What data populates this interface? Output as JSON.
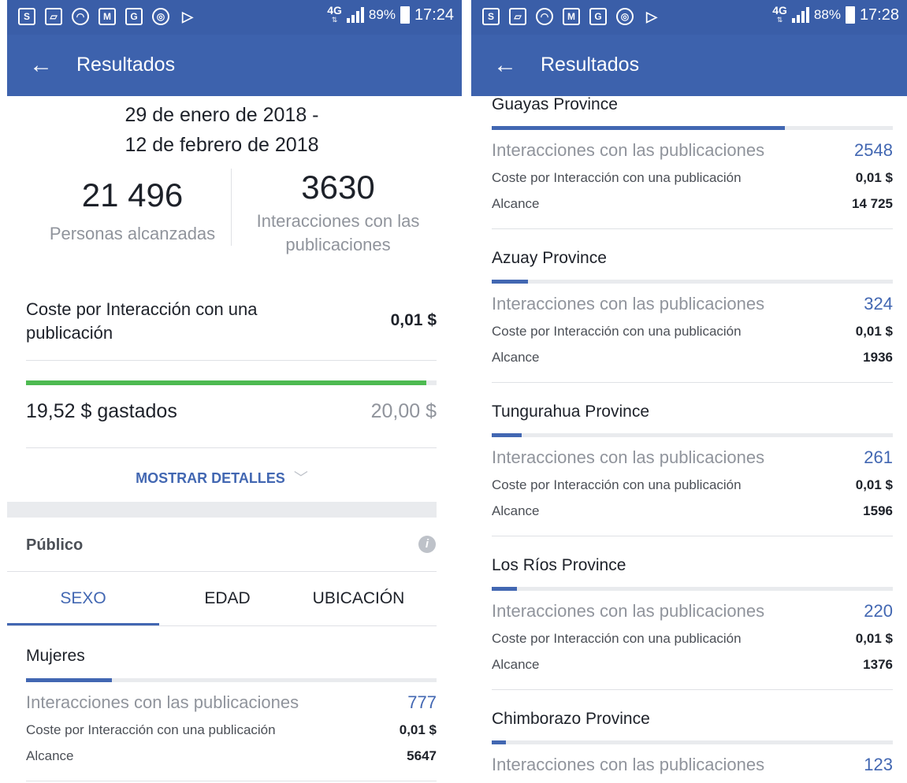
{
  "left": {
    "status": {
      "network": "4G",
      "battery": "89%",
      "time": "17:24"
    },
    "appbar": {
      "title": "Resultados"
    },
    "date_line1": "29 de enero de 2018 -",
    "date_line2": "12 de febrero de 2018",
    "reach": {
      "value": "21 496",
      "label": "Personas alcanzadas"
    },
    "engagement": {
      "value": "3630",
      "label_line1": "Interacciones con las",
      "label_line2": "publicaciones"
    },
    "cost": {
      "label_line1": "Coste por Interacción con una",
      "label_line2": "publicación",
      "value": "0,01 $"
    },
    "budget": {
      "spent": "19,52 $ gastados",
      "total": "20,00 $",
      "progress": 0.976
    },
    "show_details": "MOSTRAR DETALLES",
    "audience": {
      "title": "Público"
    },
    "tabs": [
      "SEXO",
      "EDAD",
      "UBICACIÓN"
    ],
    "active_tab": 0,
    "segment": {
      "name": "Mujeres",
      "fill": 0.21,
      "interactions_label": "Interacciones con las publicaciones",
      "interactions_value": "777",
      "cost_label": "Coste por Interacción con una publicación",
      "cost_value": "0,01 $",
      "reach_label": "Alcance",
      "reach_value": "5647"
    }
  },
  "right": {
    "status": {
      "network": "4G",
      "battery": "88%",
      "time": "17:28"
    },
    "appbar": {
      "title": "Resultados"
    },
    "labels": {
      "interactions": "Interacciones con las publicaciones",
      "cost": "Coste por Interacción con una publicación",
      "reach": "Alcance"
    },
    "provinces": [
      {
        "name": "Guayas Province",
        "fill": 0.73,
        "interactions": "2548",
        "cost": "0,01 $",
        "reach": "14 725"
      },
      {
        "name": "Azuay Province",
        "fill": 0.09,
        "interactions": "324",
        "cost": "0,01 $",
        "reach": "1936"
      },
      {
        "name": "Tungurahua Province",
        "fill": 0.075,
        "interactions": "261",
        "cost": "0,01 $",
        "reach": "1596"
      },
      {
        "name": "Los Ríos Province",
        "fill": 0.063,
        "interactions": "220",
        "cost": "0,01 $",
        "reach": "1376"
      },
      {
        "name": "Chimborazo Province",
        "fill": 0.035,
        "interactions": "123"
      }
    ]
  },
  "colors": {
    "appbar": "#3d62ad",
    "statusbar": "#3a5ea8",
    "accent_blue": "#4267b2",
    "progress_green": "#4dba51"
  }
}
